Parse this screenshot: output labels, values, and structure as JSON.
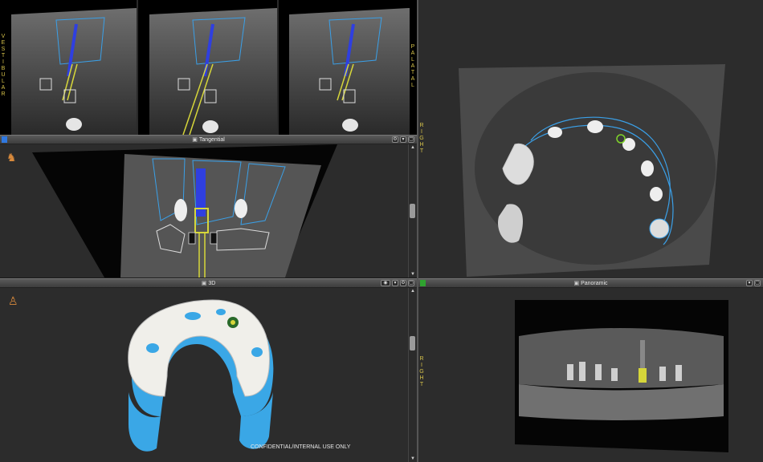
{
  "views": {
    "cross_section": {
      "side_left": [
        "V",
        "E",
        "S",
        "T",
        "I",
        "B",
        "U",
        "L",
        "A",
        "R"
      ],
      "side_right": [
        "P",
        "A",
        "L",
        "A",
        "T",
        "A",
        "L"
      ]
    },
    "tangential": {
      "title": "Tangential"
    },
    "axial": {
      "side_label": [
        "R",
        "I",
        "G",
        "H",
        "T"
      ]
    },
    "three_d": {
      "title": "3D"
    },
    "panoramic": {
      "title": "Panoramic",
      "side_label": [
        "R",
        "I",
        "G",
        "H",
        "T"
      ]
    }
  },
  "footer": {
    "notice": "CONFIDENTIAL/INTERNAL USE ONLY"
  },
  "icons": {
    "orientation_figure": "figure-icon",
    "camera": "camera-icon",
    "eye": "eye-icon",
    "window_controls": [
      "settings-icon",
      "minimize-icon",
      "maximize-icon"
    ]
  },
  "colors": {
    "accent_blue": "#2f78e0",
    "accent_green": "#2fa32f",
    "label_yellow": "#d6c24a",
    "outline_blue": "#3aa0e8"
  }
}
